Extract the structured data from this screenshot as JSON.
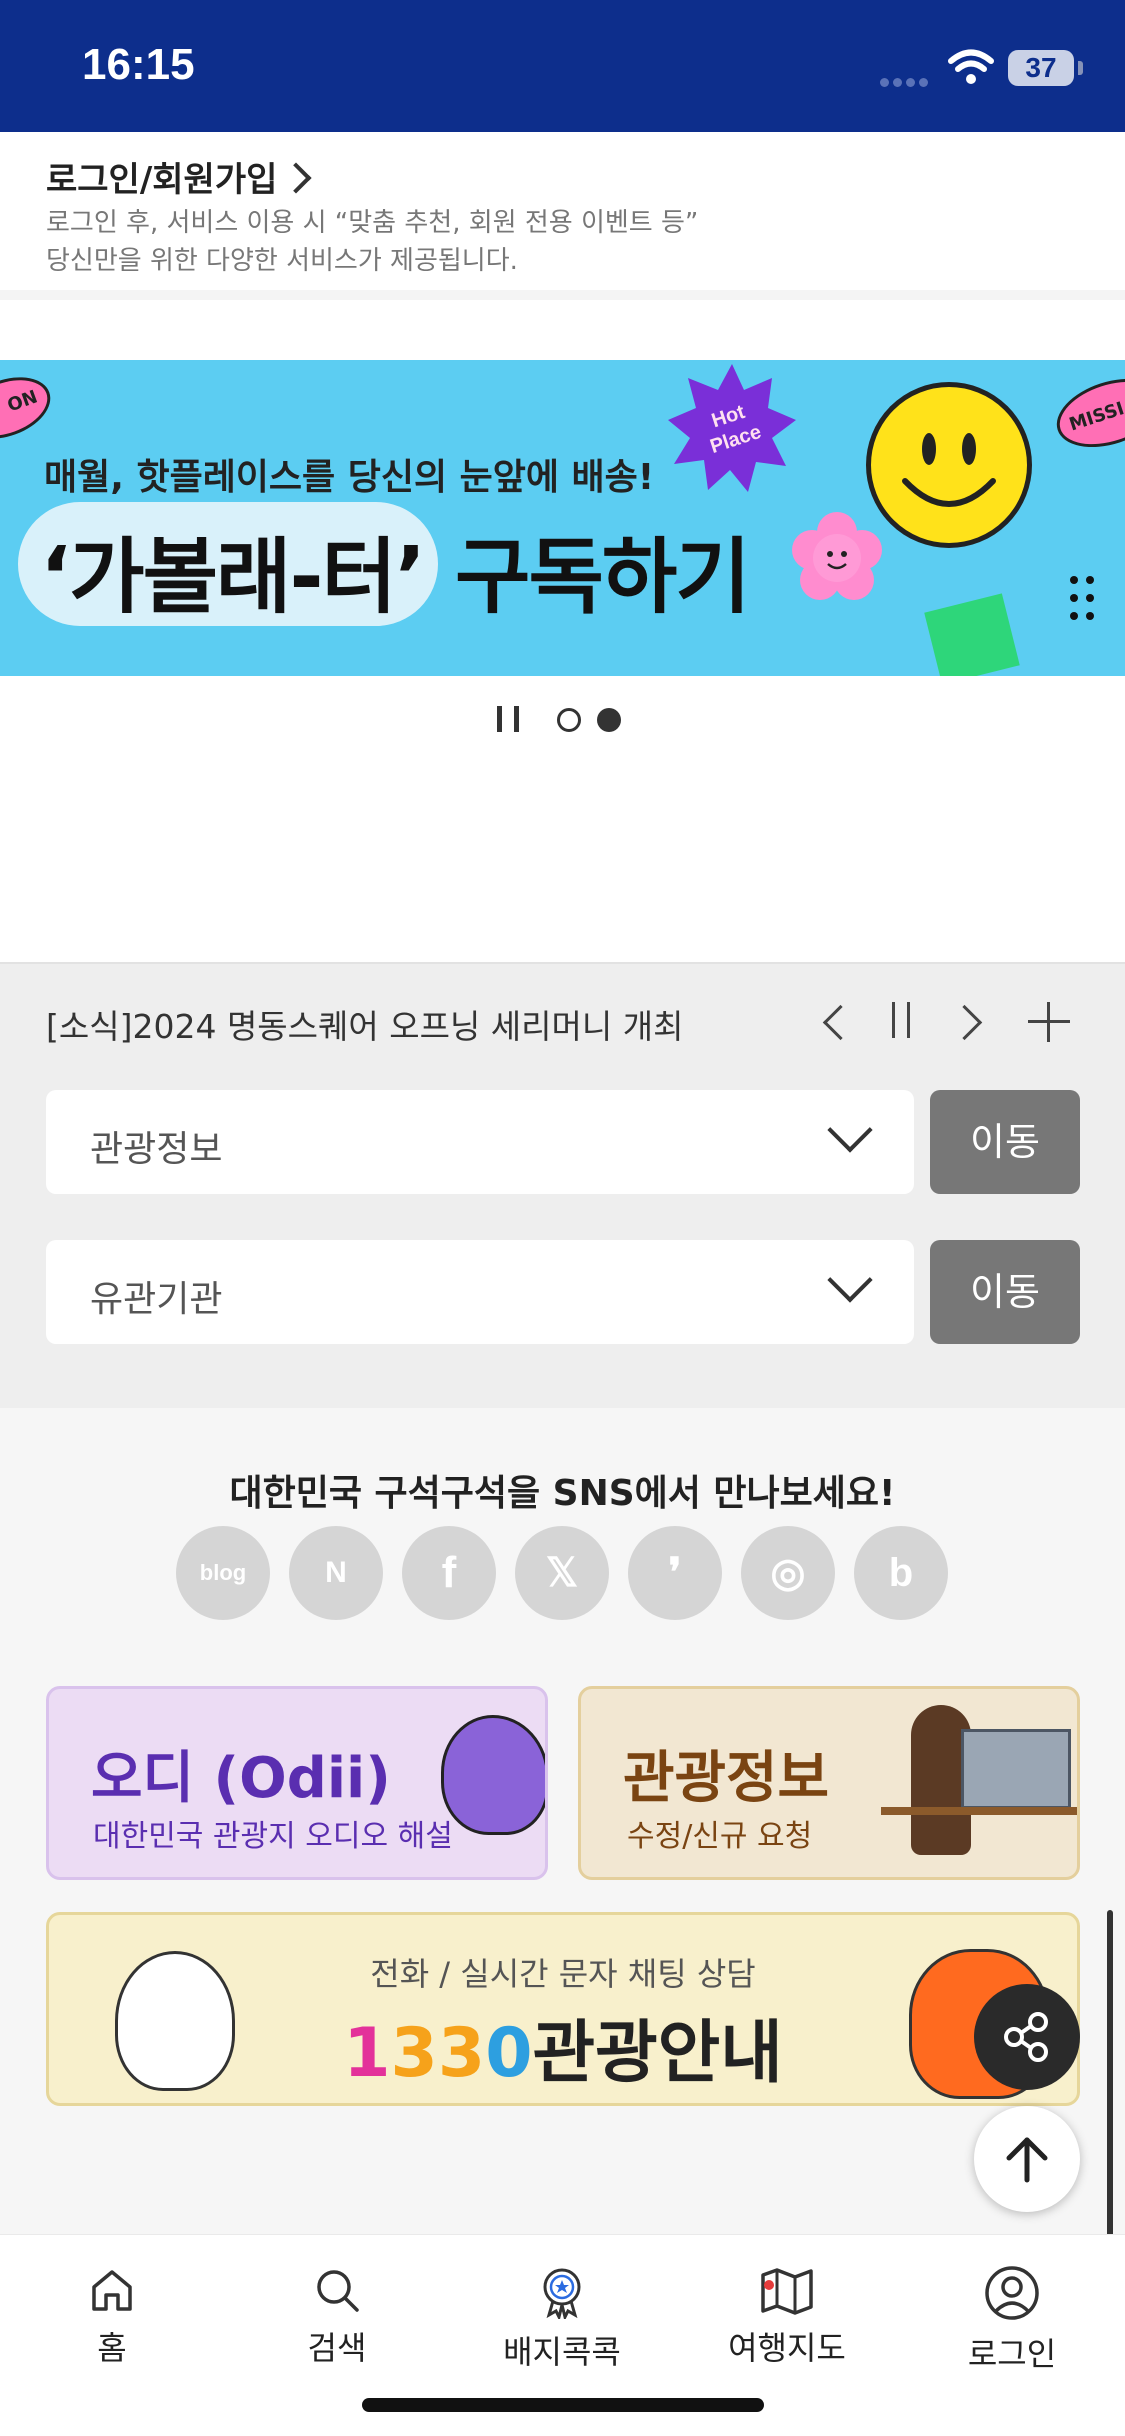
{
  "status_bar": {
    "time": "16:15",
    "battery": "37"
  },
  "login": {
    "title": "로그인/회원가입",
    "desc_line1": "로그인 후, 서비스 이용 시 “맞춤 추천, 회원 전용 이벤트 등”",
    "desc_line2": "당신만을 위한 다양한 서비스가 제공됩니다."
  },
  "banner": {
    "subtitle": "매월, 핫플레이스를 당신의 눈앞에 배송!",
    "title_left": "‘가볼래-터’",
    "title_right": "구독하기",
    "sticker_star": "Hot Place",
    "tag_left": "ON",
    "tag_right": "MISSI",
    "pager": {
      "total": 2,
      "active": 2
    }
  },
  "news": {
    "text": "[소식]2024 명동스퀘어 오프닝 세리머니 개최"
  },
  "selects": [
    {
      "value": "관광정보",
      "button": "이동"
    },
    {
      "value": "유관기관",
      "button": "이동"
    }
  ],
  "sns": {
    "title": "대한민국 구석구석을 SNS에서 만나보세요!",
    "icons": [
      {
        "name": "blog-icon",
        "glyph": "blog"
      },
      {
        "name": "naver-post-icon",
        "glyph": "N"
      },
      {
        "name": "facebook-icon",
        "glyph": "f"
      },
      {
        "name": "x-icon",
        "glyph": "𝕏"
      },
      {
        "name": "kakao-story-icon",
        "glyph": "❜"
      },
      {
        "name": "instagram-icon",
        "glyph": "◎"
      },
      {
        "name": "band-icon",
        "glyph": "b"
      }
    ]
  },
  "cards": {
    "odii": {
      "title": "오디 (Odii)",
      "sub": "대한민국 관광지 오디오 해설"
    },
    "info": {
      "title": "관광정보",
      "sub": "수정/신규 요청"
    },
    "call": {
      "sub": "전화 / 실시간 문자 채팅 상담",
      "n1": "1",
      "n2": "3",
      "n3": "3",
      "n4": "0",
      "rest": "관광안내"
    }
  },
  "tabs": [
    {
      "label": "홈",
      "icon": "home-icon"
    },
    {
      "label": "검색",
      "icon": "search-icon"
    },
    {
      "label": "배지콕콕",
      "icon": "badge-icon"
    },
    {
      "label": "여행지도",
      "icon": "map-icon"
    },
    {
      "label": "로그인",
      "icon": "user-icon"
    }
  ],
  "colors": {
    "header_bg": "#0d2e8c",
    "banner_bg": "#5ccdf2",
    "button_gray": "#777777"
  }
}
